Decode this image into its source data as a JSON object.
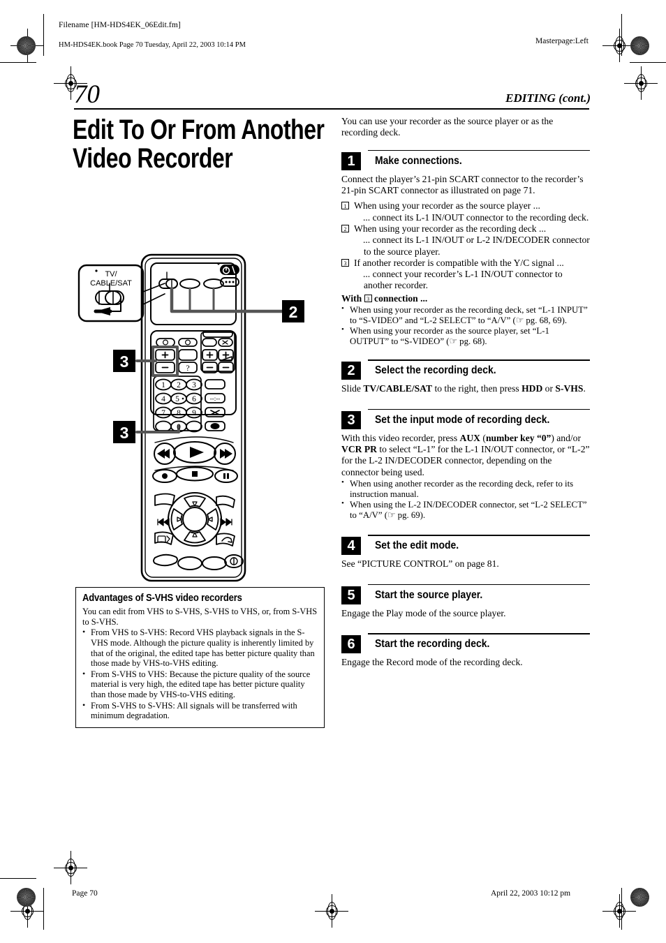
{
  "header": {
    "filename": "Filename [HM-HDS4EK_06Edit.fm]",
    "book_line": "HM-HDS4EK.book  Page 70  Tuesday, April 22, 2003  10:14 PM",
    "masterpage": "Masterpage:Left"
  },
  "page": {
    "number": "70",
    "running_head": "EDITING (cont.)",
    "title": "Edit To Or From Another Video Recorder"
  },
  "intro": "You can use your recorder as the source player or as the recording deck.",
  "steps": [
    {
      "num": "1",
      "title": "Make connections.",
      "body": "Connect the player’s 21-pin SCART connector to the recorder’s 21-pin SCART connector as illustrated on page 71.",
      "numbered_items": [
        {
          "marker": "1",
          "line1": "When using your recorder as the source player ...",
          "line2": "... connect its L-1 IN/OUT connector to the recording deck."
        },
        {
          "marker": "2",
          "line1": "When using your recorder as the recording deck ...",
          "line2": "... connect its L-1 IN/OUT or L-2 IN/DECODER connector to the source player."
        },
        {
          "marker": "3",
          "line1": "If another recorder is compatible with the Y/C signal ...",
          "line2": "... connect your recorder’s L-1 IN/OUT connector to another recorder."
        }
      ],
      "with_prefix": "With",
      "with_marker": "3",
      "with_suffix": "connection ...",
      "bullets": [
        "When using your recorder as the recording deck, set “L-1 INPUT” to “S-VIDEO” and “L-2 SELECT” to “A/V” (☞ pg. 68, 69).",
        "When using your recorder as the source player, set “L-1 OUTPUT” to “S-VIDEO” (☞ pg. 68)."
      ]
    },
    {
      "num": "2",
      "title": "Select the recording deck.",
      "body_html": "Slide <b>TV/CABLE/SAT</b> to the right, then press <b>HDD</b> or <b>S-VHS</b>."
    },
    {
      "num": "3",
      "title": "Set the input mode of recording deck.",
      "body_html": "With this video recorder, press <b>AUX</b> (<b>number key “0”</b>) and/or <b>VCR PR</b> to select “L-1” for the L-1 IN/OUT connector, or “L-2” for the L-2 IN/DECODER connector, depending on the connector being used.",
      "bullets": [
        "When using another recorder as the recording deck, refer to its instruction manual.",
        "When using the L-2 IN/DECODER connector, set “L-2 SELECT” to “A/V” (☞ pg. 69)."
      ]
    },
    {
      "num": "4",
      "title": "Set the edit mode.",
      "body": "See “PICTURE CONTROL” on page 81."
    },
    {
      "num": "5",
      "title": "Start the source player.",
      "body": "Engage the Play mode of the source player."
    },
    {
      "num": "6",
      "title": "Start the recording deck.",
      "body": "Engage the Record mode of the recording deck."
    }
  ],
  "advantages": {
    "title": "Advantages of S-VHS video recorders",
    "intro": "You can edit from VHS to S-VHS, S-VHS to VHS, or, from S-VHS to S-VHS.",
    "bullets": [
      "From VHS to S-VHS: Record VHS playback signals in the S-VHS mode. Although the picture quality is inherently limited by that of the original, the edited tape has better picture quality than those made by VHS-to-VHS editing.",
      "From S-VHS to VHS: Because the picture quality of the source material is very high, the edited tape has better picture quality than those made by VHS-to-VHS editing.",
      "From S-VHS to S-VHS: All signals will be transferred with minimum degradation."
    ]
  },
  "illustration": {
    "callout_label_line1": "TV/",
    "callout_label_line2": "CABLE/SAT",
    "marker_2": "2",
    "marker_3a": "3",
    "marker_3b": "3",
    "power_glyph": "⏻/I",
    "keypad": [
      "1",
      "2",
      "3",
      "4",
      "5",
      "6",
      "7",
      "8",
      "9",
      "0"
    ],
    "key_plus": "+",
    "key_minus": "–",
    "key_question": "?",
    "key_cross": "✕",
    "key_dashes": "--:--"
  },
  "footer": {
    "page_label": "Page 70",
    "date": "April 22, 2003 10:12 pm"
  }
}
